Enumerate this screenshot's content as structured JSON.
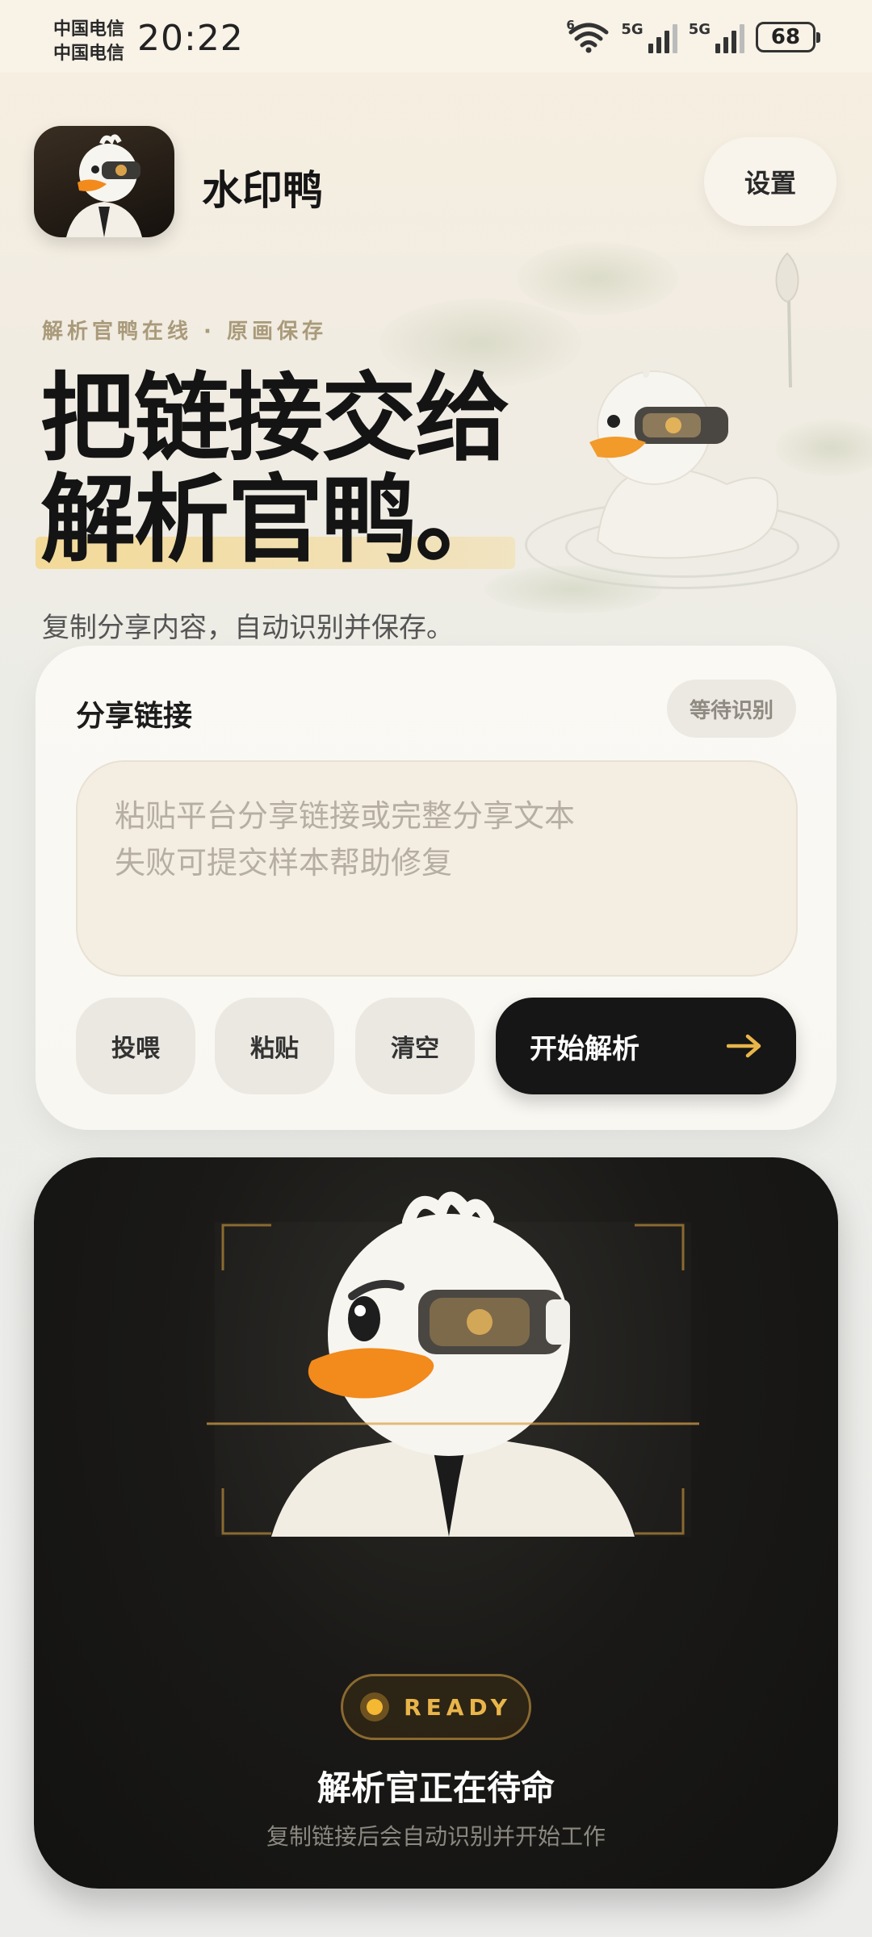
{
  "status_bar": {
    "carrier_1": "中国电信",
    "carrier_2": "中国电信",
    "time": "20:22",
    "network_1": "5G",
    "network_2": "5G",
    "wifi_badge": "6",
    "battery": "68"
  },
  "header": {
    "app_name": "水印鸭",
    "settings_label": "设置"
  },
  "hero": {
    "tagline": "解析官鸭在线 · 原画保存",
    "title_line_1": "把链接交给",
    "title_line_2": "解析官鸭。",
    "subtitle": "复制分享内容，自动识别并保存。"
  },
  "share_card": {
    "title": "分享链接",
    "status": "等待识别",
    "placeholder_line_1": "粘贴平台分享链接或完整分享文本",
    "placeholder_line_2": "失败可提交样本帮助修复",
    "buttons": {
      "feed": "投喂",
      "paste": "粘贴",
      "clear": "清空",
      "start": "开始解析",
      "start_icon": "arrow-right-icon"
    }
  },
  "ready_card": {
    "badge": "READY",
    "title": "解析官正在待命",
    "subtitle": "复制链接后会自动识别并开始工作"
  },
  "colors": {
    "accent_gold": "#e9b54a",
    "dark": "#161616",
    "card_bg": "#fbf9f4"
  }
}
